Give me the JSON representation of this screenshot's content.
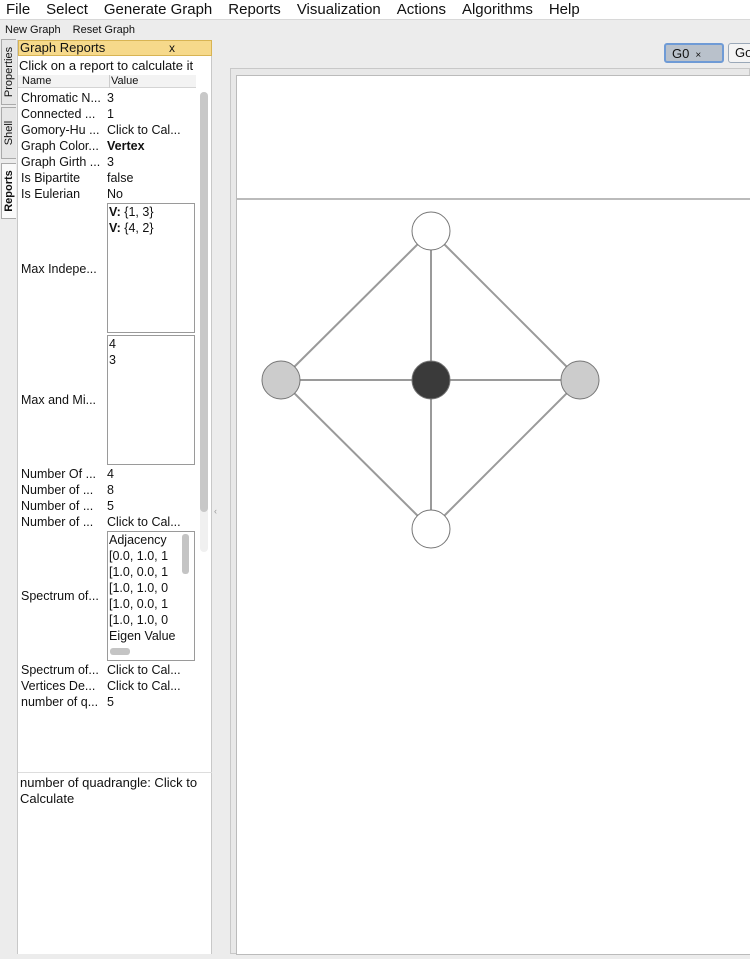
{
  "menu": [
    "File",
    "Select",
    "Generate Graph",
    "Reports",
    "Visualization",
    "Actions",
    "Algorithms",
    "Help"
  ],
  "toolbar": {
    "new_graph": "New Graph",
    "reset_graph": "Reset Graph"
  },
  "side_tabs": [
    "Properties",
    "Shell",
    "Reports"
  ],
  "panel": {
    "title": "Graph Reports",
    "close": "x",
    "hint": "Click on a report to calculate it",
    "col_name": "Name",
    "col_value": "Value"
  },
  "reports": [
    {
      "name": "Chromatic N...",
      "value": "3"
    },
    {
      "name": "Connected ...",
      "value": "1"
    },
    {
      "name": "Gomory-Hu ...",
      "value": "Click to Cal..."
    },
    {
      "name": "Graph Color...",
      "value": "Vertex"
    },
    {
      "name": "Graph Girth ...",
      "value": "3"
    },
    {
      "name": "Is Bipartite",
      "value": "false"
    },
    {
      "name": "Is Eulerian",
      "value": "No"
    }
  ],
  "max_independent": {
    "name": "Max Indepe...",
    "lines": [
      {
        "label": "V:",
        "set": "{1, 3}"
      },
      {
        "label": "V:",
        "set": "{4, 2}"
      }
    ]
  },
  "max_min": {
    "name": "Max and Mi...",
    "lines": [
      "4",
      "3"
    ]
  },
  "reports2": [
    {
      "name": "Number Of ...",
      "value": "4"
    },
    {
      "name": "Number of ...",
      "value": "8"
    },
    {
      "name": "Number of ...",
      "value": "5"
    },
    {
      "name": "Number of ...",
      "value": "Click to Cal..."
    }
  ],
  "spectrum": {
    "name": "Spectrum of...",
    "lines": [
      "Adjacency",
      "[0.0, 1.0, 1",
      "[1.0, 0.0, 1",
      "[1.0, 1.0, 0",
      "[1.0, 0.0, 1",
      "[1.0, 1.0, 0",
      "Eigen Value"
    ]
  },
  "reports3": [
    {
      "name": "Spectrum of...",
      "value": "Click to Cal..."
    },
    {
      "name": "Vertices De...",
      "value": "Click to Cal..."
    },
    {
      "name": "number of q...",
      "value": "5"
    }
  ],
  "description": "number of quadrangle: Click to Calculate",
  "graph_tabs": {
    "active": "G0",
    "active_close": "×",
    "other": "Go"
  },
  "graph": {
    "vertices": [
      {
        "id": "top",
        "fill": "#ffffff"
      },
      {
        "id": "left",
        "fill": "#cccccc"
      },
      {
        "id": "center",
        "fill": "#3a3a3a"
      },
      {
        "id": "right",
        "fill": "#cccccc"
      },
      {
        "id": "bottom",
        "fill": "#ffffff"
      }
    ],
    "edges": [
      [
        "top",
        "left"
      ],
      [
        "top",
        "center"
      ],
      [
        "top",
        "right"
      ],
      [
        "left",
        "center"
      ],
      [
        "center",
        "right"
      ],
      [
        "left",
        "bottom"
      ],
      [
        "center",
        "bottom"
      ],
      [
        "right",
        "bottom"
      ]
    ],
    "edge_color": "#9a9a9a"
  }
}
